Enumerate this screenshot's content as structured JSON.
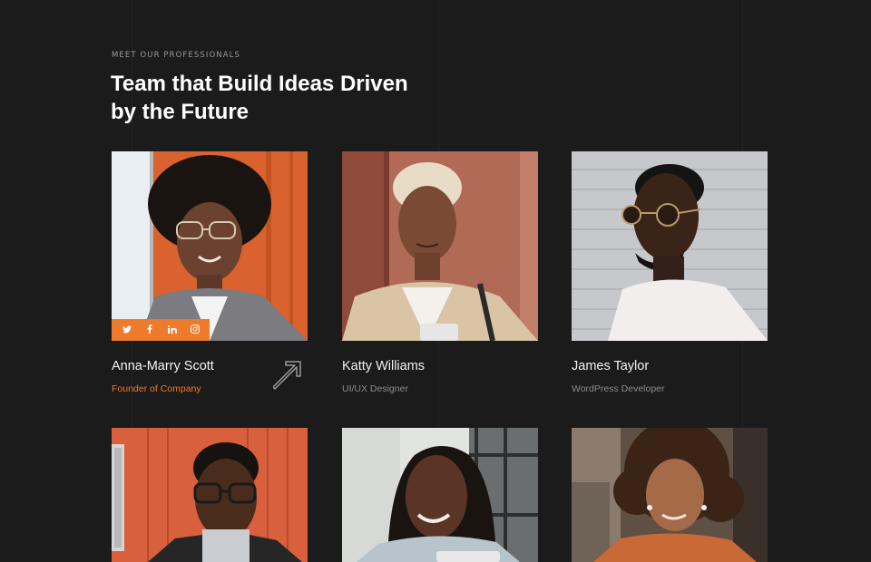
{
  "section": {
    "eyebrow": "MEET OUR PROFESSIONALS",
    "title": "Team that Build Ideas Driven by the Future"
  },
  "team": [
    {
      "name": "Anna-Marry Scott",
      "role": "Founder of Company",
      "highlighted": true
    },
    {
      "name": "Katty Williams",
      "role": "UI/UX Designer"
    },
    {
      "name": "James Taylor",
      "role": "WordPress Developer"
    },
    {
      "name": "",
      "role": ""
    },
    {
      "name": "",
      "role": ""
    },
    {
      "name": "",
      "role": ""
    }
  ],
  "social": {
    "twitter": "twitter-icon",
    "facebook": "facebook-icon",
    "linkedin": "linkedin-icon",
    "instagram": "instagram-icon"
  },
  "colors": {
    "background": "#1b1b1b",
    "accent": "#ee7a2c",
    "muted_text": "#8c8c8c"
  }
}
